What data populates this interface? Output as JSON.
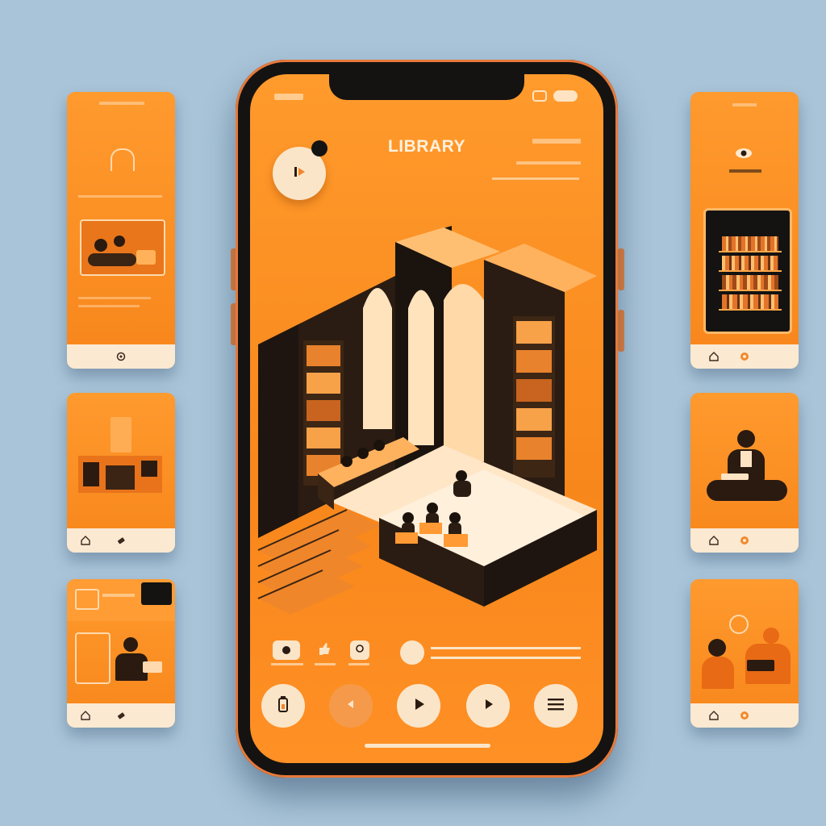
{
  "app": {
    "title": "LIBRARY"
  },
  "colors": {
    "background": "#a9c4d8",
    "accent": "#f7861b",
    "cream": "#fbe9d2",
    "dark": "#141312"
  },
  "icons": {
    "play": "play-icon",
    "prev": "previous-icon",
    "next": "next-icon",
    "menu": "menu-icon",
    "battery": "battery-icon",
    "home": "home-icon",
    "bookmark": "bookmark-icon",
    "eye": "eye-icon"
  },
  "player": {
    "progress": 0.0
  }
}
